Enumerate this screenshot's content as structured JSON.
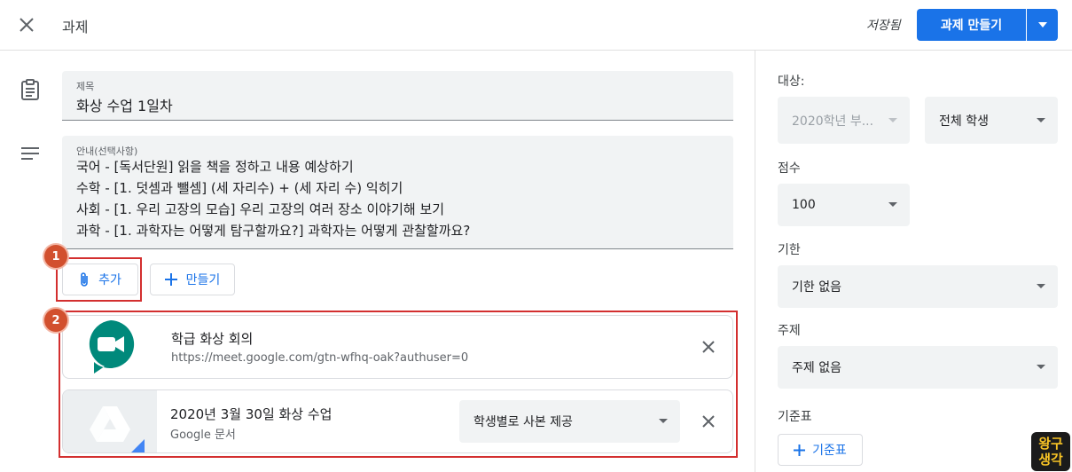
{
  "header": {
    "title": "과제",
    "saved": "저장됨",
    "create_label": "과제 만들기"
  },
  "main": {
    "title_field": {
      "label": "제목",
      "value": "화상 수업 1일차"
    },
    "description_field": {
      "label": "안내(선택사항)",
      "lines": [
        "국어 - [독서단원] 읽을 책을 정하고 내용 예상하기",
        "수학 - [1. 덧셈과 뺄셈] (세 자리수) + (세 자리 수) 익히기",
        "사회 - [1. 우리 고장의 모습] 우리 고장의 여러 장소 이야기해 보기",
        "과학 - [1. 과학자는 어떻게 탐구할까요?] 과학자는 어떻게 관찰할까요?"
      ]
    },
    "add_button": "추가",
    "create_button": "만들기",
    "annotations": [
      "1",
      "2"
    ],
    "attachments": [
      {
        "title": "학급 화상 회의",
        "subtitle": "https://meet.google.com/gtn-wfhq-oak?authuser=0",
        "icon": "google-meet-icon"
      },
      {
        "title": "2020년 3월 30일 화상 수업",
        "subtitle": "Google 문서",
        "icon": "google-drive-icon",
        "share_option": "학생별로 사본 제공"
      }
    ]
  },
  "sidebar": {
    "for_label": "대상:",
    "class_value": "2020학년 부...",
    "students_value": "전체 학생",
    "points_label": "점수",
    "points_value": "100",
    "due_label": "기한",
    "due_value": "기한 없음",
    "topic_label": "주제",
    "topic_value": "주제 없음",
    "rubric_label": "기준표",
    "rubric_button": "기준표"
  },
  "watermark": {
    "line1": "왕구",
    "line2": "생각"
  },
  "colors": {
    "primary": "#1a73e8",
    "annotation": "#d32f2f",
    "badge": "#d2502e",
    "meet_green": "#00897b"
  }
}
